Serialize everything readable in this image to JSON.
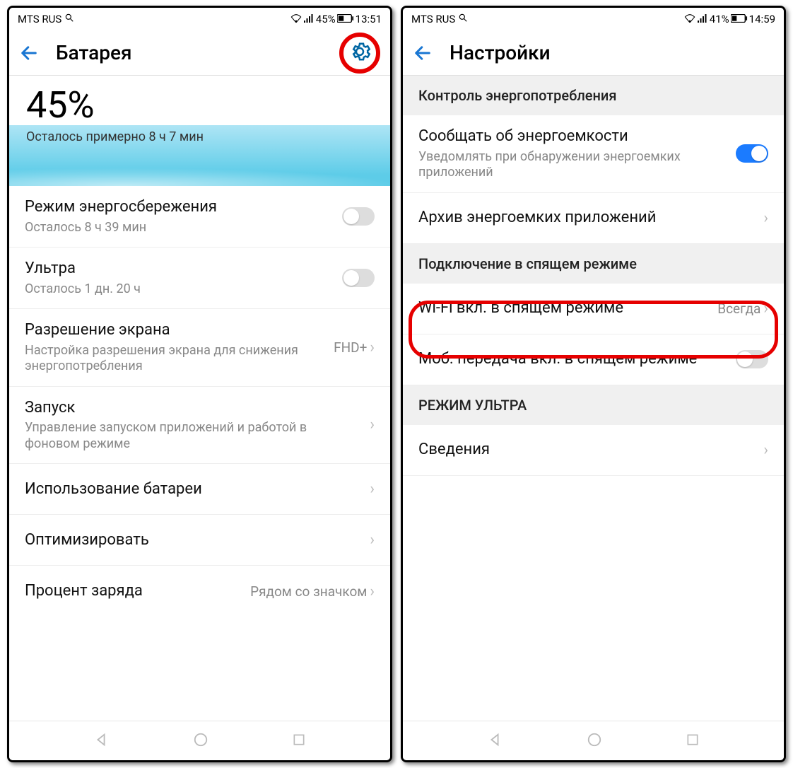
{
  "left": {
    "status": {
      "carrier": "MTS RUS",
      "battery": "45%",
      "time": "13:51"
    },
    "title": "Батарея",
    "hero": {
      "pct": "45%",
      "sub": "Осталось примерно 8 ч 7 мин"
    },
    "rows": {
      "power_saving": {
        "title": "Режим энергосбережения",
        "sub": "Осталось 8 ч 39 мин"
      },
      "ultra": {
        "title": "Ультра",
        "sub": "Осталось 1 дн. 20 ч"
      },
      "resolution": {
        "title": "Разрешение экрана",
        "sub": "Настройка разрешения экрана для снижения энергопотребления",
        "value": "FHD+"
      },
      "launch": {
        "title": "Запуск",
        "sub": "Управление запуском приложений и работой в фоновом режиме"
      },
      "usage": {
        "title": "Использование батареи"
      },
      "optimize": {
        "title": "Оптимизировать"
      },
      "percent": {
        "title": "Процент заряда",
        "value": "Рядом со значком"
      }
    }
  },
  "right": {
    "status": {
      "carrier": "MTS RUS",
      "battery": "41%",
      "time": "14:59"
    },
    "title": "Настройки",
    "sections": {
      "s1": "Контроль энергопотребления",
      "s2": "Подключение в спящем режиме",
      "s3": "РЕЖИМ УЛЬТРА"
    },
    "rows": {
      "notify": {
        "title": "Сообщать об энергоемкости",
        "sub": "Уведомлять при обнаружении энергоемких приложений"
      },
      "archive": {
        "title": "Архив энергоемких приложений"
      },
      "wifi": {
        "title": "Wi-Fi вкл. в спящем режиме",
        "value": "Всегда"
      },
      "mobile": {
        "title": "Моб. передача вкл. в спящем режиме"
      },
      "info": {
        "title": "Сведения"
      }
    }
  }
}
